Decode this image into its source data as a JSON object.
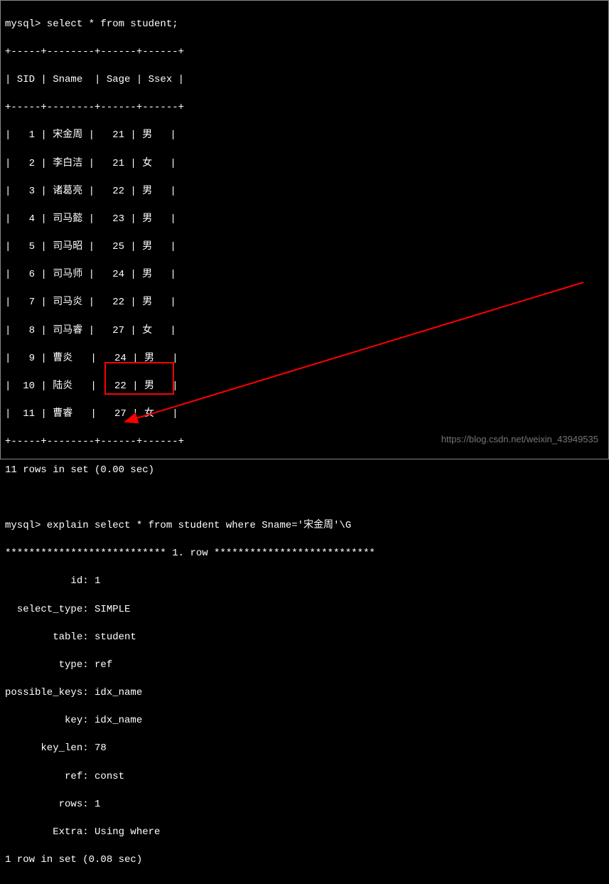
{
  "prompt1": "mysql> select * from student;",
  "table": {
    "border": "+-----+--------+------+------+",
    "header": "| SID | Sname  | Sage | Ssex |",
    "rows": [
      "|   1 | 宋金周 |   21 | 男   |",
      "|   2 | 李白洁 |   21 | 女   |",
      "|   3 | 诸葛亮 |   22 | 男   |",
      "|   4 | 司马懿 |   23 | 男   |",
      "|   5 | 司马昭 |   25 | 男   |",
      "|   6 | 司马师 |   24 | 男   |",
      "|   7 | 司马炎 |   22 | 男   |",
      "|   8 | 司马睿 |   27 | 女   |",
      "|   9 | 曹炎   |   24 | 男   |",
      "|  10 | 陆炎   |   22 | 男   |",
      "|  11 | 曹睿   |   27 | 女   |"
    ]
  },
  "result1": "11 rows in set (0.00 sec)",
  "prompt2": "mysql> explain select * from student where Sname='宋金周'\\G",
  "row_marker": "*************************** 1. row ***************************",
  "explain": {
    "id": "           id: 1",
    "select_type": "  select_type: SIMPLE",
    "table": "        table: student",
    "type": "         type: ref",
    "possible_keys": "possible_keys: idx_name",
    "key": "          key: idx_name",
    "key_len": "      key_len: 78",
    "ref": "          ref: const",
    "rows": "         rows: 1",
    "extra": "        Extra: Using where"
  },
  "result2": "1 row in set (0.08 sec)",
  "watermark": "https://blog.csdn.net/weixin_43949535",
  "chart_data": {
    "type": "table",
    "title": "student",
    "columns": [
      "SID",
      "Sname",
      "Sage",
      "Ssex"
    ],
    "rows": [
      [
        1,
        "宋金周",
        21,
        "男"
      ],
      [
        2,
        "李白洁",
        21,
        "女"
      ],
      [
        3,
        "诸葛亮",
        22,
        "男"
      ],
      [
        4,
        "司马懿",
        23,
        "男"
      ],
      [
        5,
        "司马昭",
        25,
        "男"
      ],
      [
        6,
        "司马师",
        24,
        "男"
      ],
      [
        7,
        "司马炎",
        22,
        "男"
      ],
      [
        8,
        "司马睿",
        27,
        "女"
      ],
      [
        9,
        "曹炎",
        24,
        "男"
      ],
      [
        10,
        "陆炎",
        22,
        "男"
      ],
      [
        11,
        "曹睿",
        27,
        "女"
      ]
    ],
    "explain_plan": {
      "id": 1,
      "select_type": "SIMPLE",
      "table": "student",
      "type": "ref",
      "possible_keys": "idx_name",
      "key": "idx_name",
      "key_len": 78,
      "ref": "const",
      "rows": 1,
      "Extra": "Using where"
    }
  }
}
